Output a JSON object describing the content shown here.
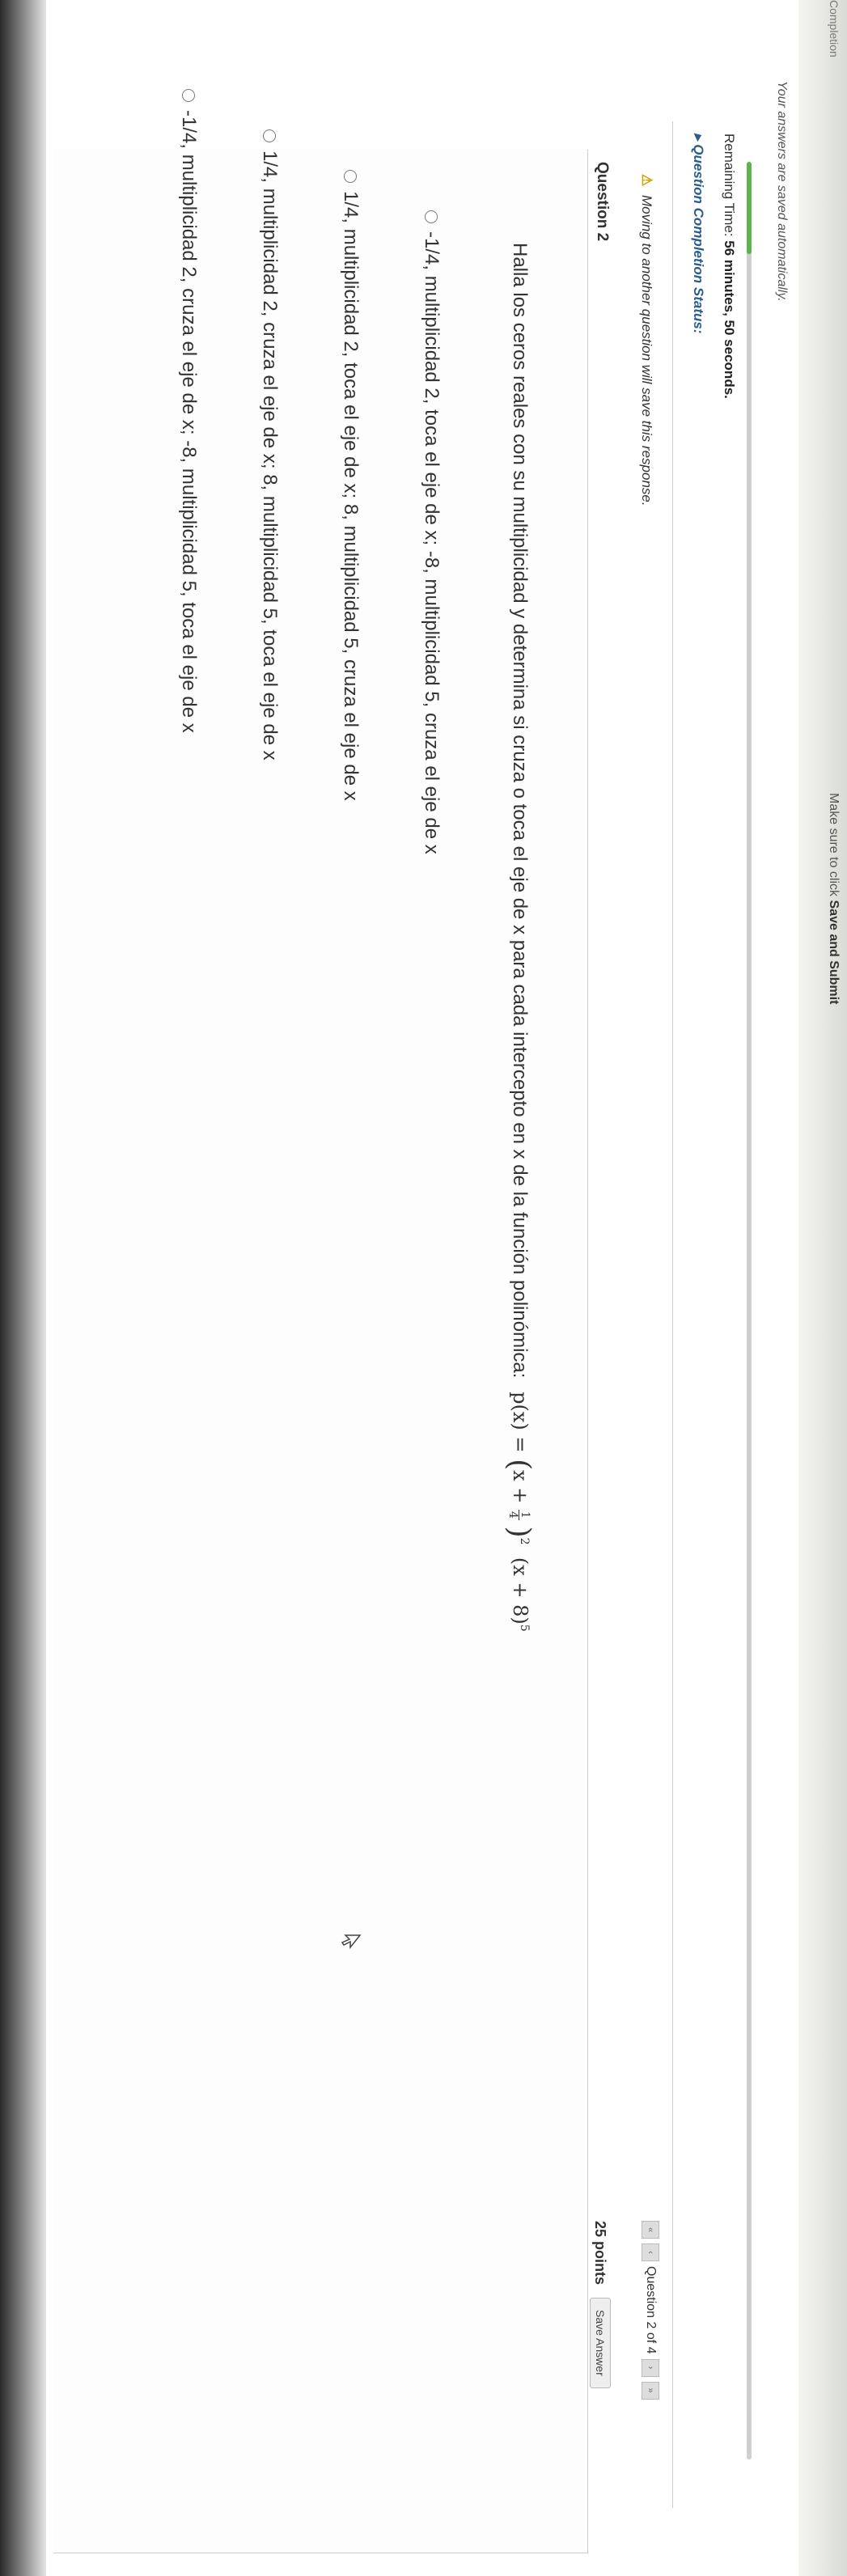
{
  "header": {
    "section_title": "Completion",
    "instructions_end": "Make sure to click",
    "instructions_bold": "Save and Submit"
  },
  "saved_note": "Your answers are saved automatically.",
  "timer": {
    "progress_fraction": 0.04,
    "remaining_label": "Remaining Time:",
    "remaining_value": "56 minutes, 50 seconds."
  },
  "completion_status_label": "Question Completion Status:",
  "warning": "Moving to another question will save this response.",
  "navigation": {
    "label": "Question 2 of 4"
  },
  "question": {
    "heading": "Question 2",
    "points": "25 points",
    "save_label": "Save Answer",
    "text": "Halla los ceros reales con su multiplicidad y determina si cruza o toca el eje de x para cada intercepto en x de la función polinómica:",
    "func_lhs": "p(x) = ",
    "func_frac_num": "1",
    "func_frac_den": "4",
    "func_exp1": "2",
    "func_rest": "(x + 8)",
    "func_exp2": "5"
  },
  "options": [
    "-1/4, multiplicidad 2, toca el eje de x; -8, multiplicidad 5, cruza el eje de x",
    "1/4, multiplicidad 2, toca el eje de x; 8, multiplicidad 5, cruza el eje de x",
    "1/4, multiplicidad 2, cruza el eje de x; 8, multiplicidad 5, toca el eje de x",
    "-1/4, multiplicidad 2, cruza el eje de x; -8, multiplicidad 5, toca el eje de x"
  ],
  "colors": {
    "accent_green": "#5fb34c",
    "warning_yellow": "#d8a000",
    "link_blue": "#2a5d8f"
  }
}
